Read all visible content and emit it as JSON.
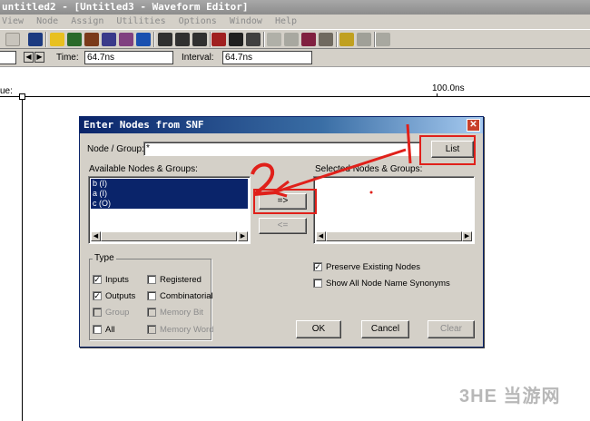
{
  "window": {
    "title": "untitled2 - [Untitled3 - Waveform Editor]"
  },
  "menu": {
    "items": [
      "View",
      "Node",
      "Assign",
      "Utilities",
      "Options",
      "Window",
      "Help"
    ]
  },
  "timebar": {
    "time_label": "Time:",
    "time_value": "64.7ns",
    "interval_label": "Interval:",
    "interval_value": "64.7ns"
  },
  "waveform": {
    "value_label": "ue:",
    "time_marker": "100.0ns"
  },
  "dialog": {
    "title": "Enter Nodes from SNF",
    "close_glyph": "✕",
    "node_group_label": "Node / Group:",
    "node_group_value": "*",
    "list_button": "List",
    "available_label": "Available Nodes & Groups:",
    "available_items": [
      "b (I)",
      "a (I)",
      "c (O)"
    ],
    "selected_label": "Selected Nodes & Groups:",
    "add_button": "=>",
    "remove_button": "<=",
    "type_group_label": "Type",
    "type_options": {
      "inputs": {
        "label": "Inputs",
        "checked": true,
        "enabled": true
      },
      "registered": {
        "label": "Registered",
        "checked": false,
        "enabled": true
      },
      "outputs": {
        "label": "Outputs",
        "checked": true,
        "enabled": true
      },
      "combinatorial": {
        "label": "Combinatorial",
        "checked": false,
        "enabled": true
      },
      "group": {
        "label": "Group",
        "checked": false,
        "enabled": false
      },
      "memory_bit": {
        "label": "Memory Bit",
        "checked": false,
        "enabled": false
      },
      "all": {
        "label": "All",
        "checked": false,
        "enabled": true
      },
      "memory_word": {
        "label": "Memory Word",
        "checked": false,
        "enabled": false
      }
    },
    "preserve_existing": {
      "label": "Preserve Existing Nodes",
      "checked": true
    },
    "show_synonyms": {
      "label": "Show All Node Name Synonyms",
      "checked": false
    },
    "ok_button": "OK",
    "cancel_button": "Cancel",
    "clear_button": "Clear"
  },
  "annotations": {
    "step1": "1",
    "step2": "2",
    "color": "#e0201a"
  },
  "watermark": {
    "text": "3HE 当游网"
  }
}
